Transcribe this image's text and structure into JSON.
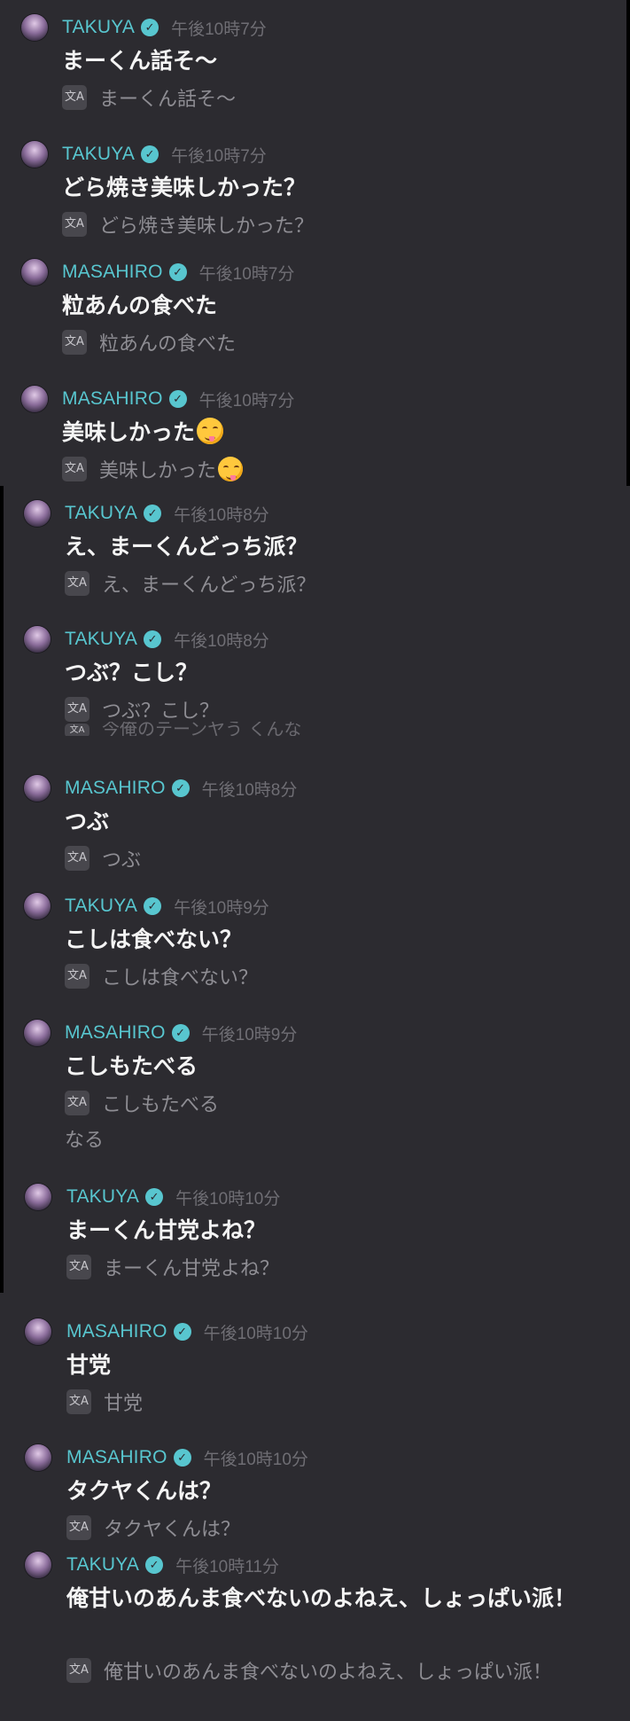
{
  "messages": [
    {
      "user": "TAKUYA",
      "time": "午後10時7分",
      "text": "まーくん話そ〜",
      "translation": "まーくん話そ〜"
    },
    {
      "user": "TAKUYA",
      "time": "午後10時7分",
      "text": "どら焼き美味しかった？",
      "translation": "どら焼き美味しかった？"
    },
    {
      "user": "MASAHIRO",
      "time": "午後10時7分",
      "text": "粒あんの食べた",
      "translation": "粒あんの食べた"
    },
    {
      "user": "MASAHIRO",
      "time": "午後10時7分",
      "text": "美味しかった",
      "translation": "美味しかった",
      "emoji": "yum-emoji"
    },
    {
      "user": "TAKUYA",
      "time": "午後10時8分",
      "text": "え、まーくんどっち派？",
      "translation": "え、まーくんどっち派？"
    },
    {
      "user": "TAKUYA",
      "time": "午後10時8分",
      "text": "つぶ？こし？",
      "translation": "つぶ？こし？"
    },
    {
      "user": "MASAHIRO",
      "time": "午後10時8分",
      "text": "つぶ",
      "translation": "つぶ"
    },
    {
      "user": "TAKUYA",
      "time": "午後10時9分",
      "text": "こしは食べない？",
      "translation": "こしは食べない？"
    },
    {
      "user": "MASAHIRO",
      "time": "午後10時9分",
      "text": "こしもたべる",
      "translation": "こしもたべる"
    },
    {
      "user": "TAKUYA",
      "time": "午後10時10分",
      "text": "まーくん甘党よね？",
      "translation": "まーくん甘党よね？"
    },
    {
      "user": "MASAHIRO",
      "time": "午後10時10分",
      "text": "甘党",
      "translation": "甘党"
    },
    {
      "user": "MASAHIRO",
      "time": "午後10時10分",
      "text": "タクヤくんは？",
      "translation": "タクヤくんは？"
    },
    {
      "user": "TAKUYA",
      "time": "午後10時11分",
      "text": "俺甘いのあんま食べないのよねえ、しょっぱい派！",
      "translation": "俺甘いのあんま食べないのよねえ、しょっぱい派！"
    }
  ],
  "fragments": {
    "cut_line": "今俺のテーンヤう くんな",
    "stray_text": "なる"
  },
  "icons": {
    "verified": "verified-badge-icon",
    "translate": "translate-icon"
  },
  "colors": {
    "background": "#2c2b30",
    "username": "#58c6cf",
    "timestamp": "#6f6e74",
    "message": "#f4f4f4",
    "translation": "#8e8d93"
  }
}
